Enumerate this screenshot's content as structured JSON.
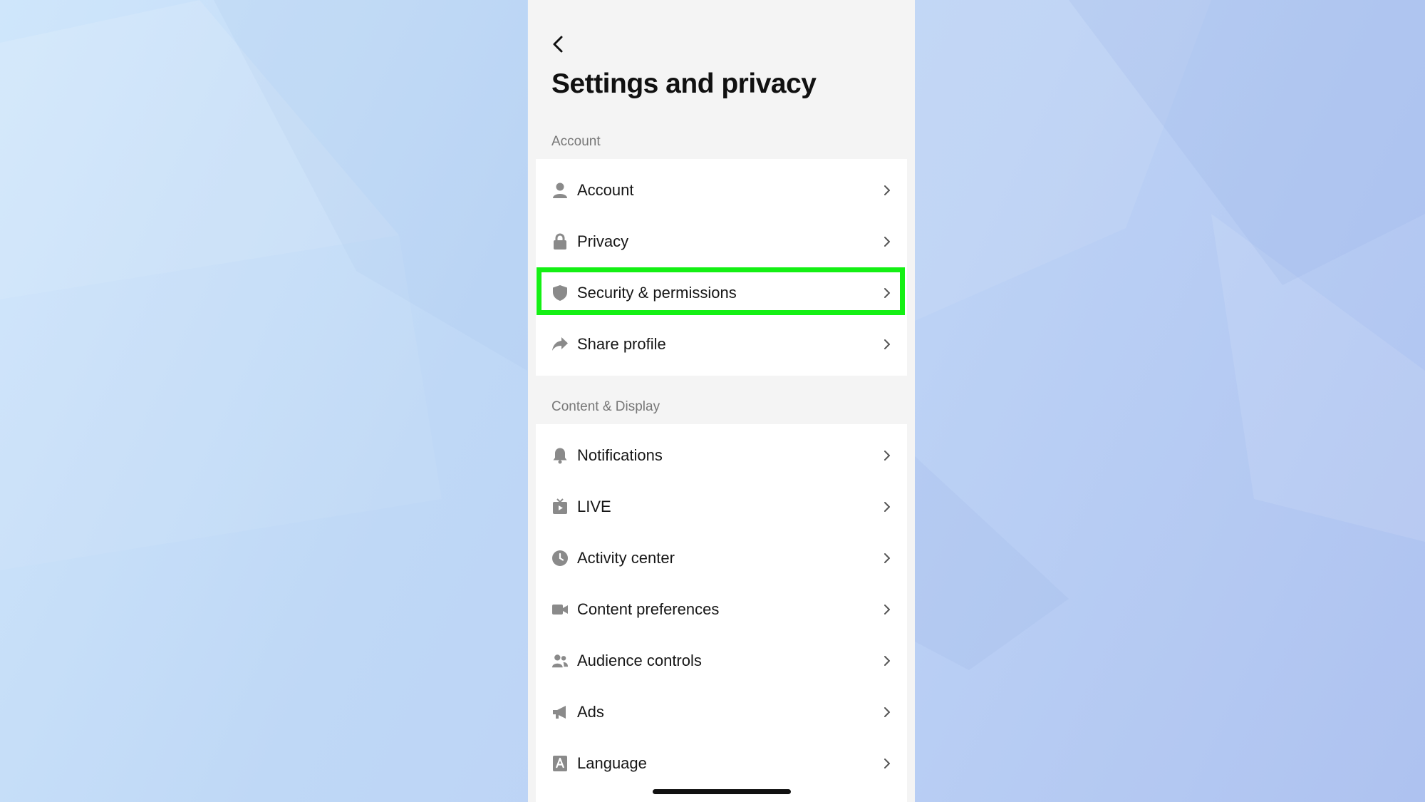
{
  "header": {
    "title": "Settings and privacy"
  },
  "sections": [
    {
      "label": "Account",
      "items": [
        {
          "label": "Account",
          "icon": "person-icon"
        },
        {
          "label": "Privacy",
          "icon": "lock-icon"
        },
        {
          "label": "Security & permissions",
          "icon": "shield-icon",
          "highlighted": true
        },
        {
          "label": "Share profile",
          "icon": "share-arrow-icon"
        }
      ]
    },
    {
      "label": "Content & Display",
      "items": [
        {
          "label": "Notifications",
          "icon": "bell-icon"
        },
        {
          "label": "LIVE",
          "icon": "live-tv-icon"
        },
        {
          "label": "Activity center",
          "icon": "clock-icon"
        },
        {
          "label": "Content preferences",
          "icon": "video-camera-icon"
        },
        {
          "label": "Audience controls",
          "icon": "people-icon"
        },
        {
          "label": "Ads",
          "icon": "megaphone-icon"
        },
        {
          "label": "Language",
          "icon": "language-a-icon"
        }
      ]
    }
  ],
  "colors": {
    "highlight": "#14f014",
    "icon": "#8a8a8a",
    "panel_background": "#f4f4f4"
  }
}
